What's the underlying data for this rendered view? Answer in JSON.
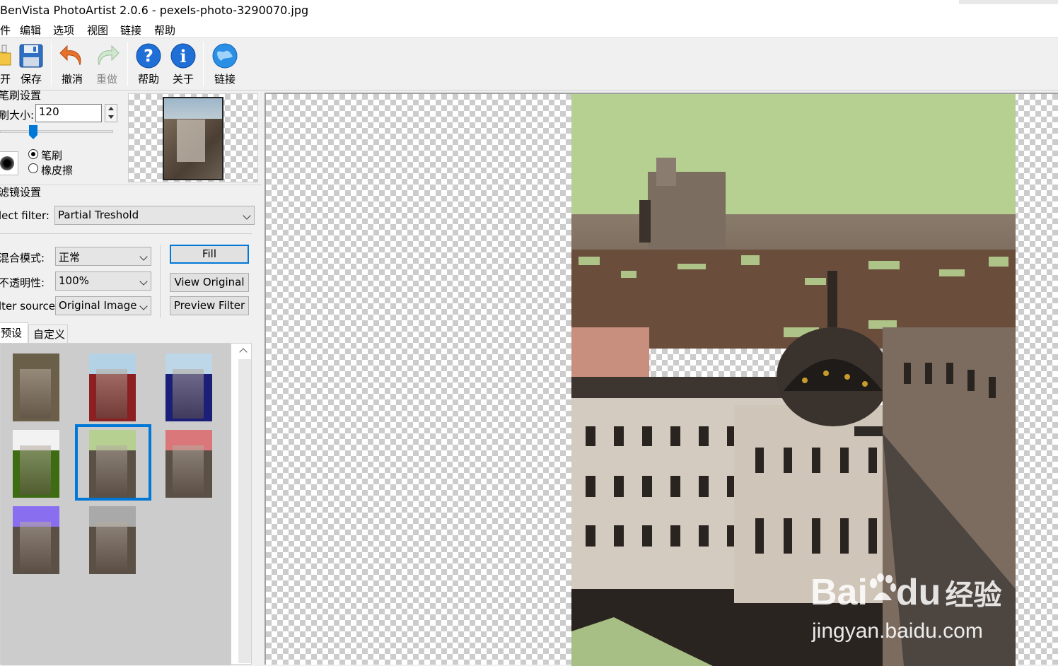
{
  "window": {
    "title": "BenVista PhotoArtist 2.0.6 - pexels-photo-3290070.jpg"
  },
  "menu": [
    "件",
    "编辑",
    "选项",
    "视图",
    "链接",
    "帮助"
  ],
  "toolbar": {
    "open": "开",
    "save": "保存",
    "undo": "撤消",
    "redo": "重做",
    "help": "帮助",
    "about": "关于",
    "link": "链接"
  },
  "brush": {
    "section_title": "笔刷设置",
    "size_label": "刷大小:",
    "size_value": "120",
    "size_level": 0.4,
    "mode_brush": "笔刷",
    "mode_eraser": "橡皮擦",
    "mode_selected": "笔刷"
  },
  "filter": {
    "section_title": "滤镜设置",
    "select_label": "lect filter:",
    "select_value": "Partial Treshold",
    "blend_label": "混合模式:",
    "blend_value": "正常",
    "opacity_label": "不透明性:",
    "opacity_value": "100%",
    "source_label": "lter source:",
    "source_value": "Original Image",
    "fill_button": "Fill",
    "view_original_button": "View Original",
    "preview_filter_button": "Preview Filter"
  },
  "presets": {
    "tabs": [
      "预设",
      "自定义"
    ],
    "active_tab": "预设",
    "selected_index": 4,
    "items": [
      {
        "name": "preset-1",
        "sky": "#6a5f48",
        "tint": "#6b5f4a"
      },
      {
        "name": "preset-2",
        "sky": "#b3d2e6",
        "tint": "#8b1f22"
      },
      {
        "name": "preset-3",
        "sky": "#bdd6e8",
        "tint": "#1c1f78"
      },
      {
        "name": "preset-4",
        "sky": "#f2f2f2",
        "tint": "#3d6c12"
      },
      {
        "name": "preset-5",
        "sky": "#b5d090",
        "tint": "#5b5046"
      },
      {
        "name": "preset-6",
        "sky": "#d9777a",
        "tint": "#5b5046"
      },
      {
        "name": "preset-7",
        "sky": "#8a6ef0",
        "tint": "#5b5046"
      },
      {
        "name": "preset-8",
        "sky": "#a9a9a9",
        "tint": "#5b5046"
      }
    ]
  },
  "watermark": {
    "brand": "Bai",
    "brand2": "du",
    "cn": "经验",
    "url": "jingyan.baidu.com"
  },
  "colors": {
    "accent": "#0078d7",
    "filter_sky": "#b5d090"
  }
}
